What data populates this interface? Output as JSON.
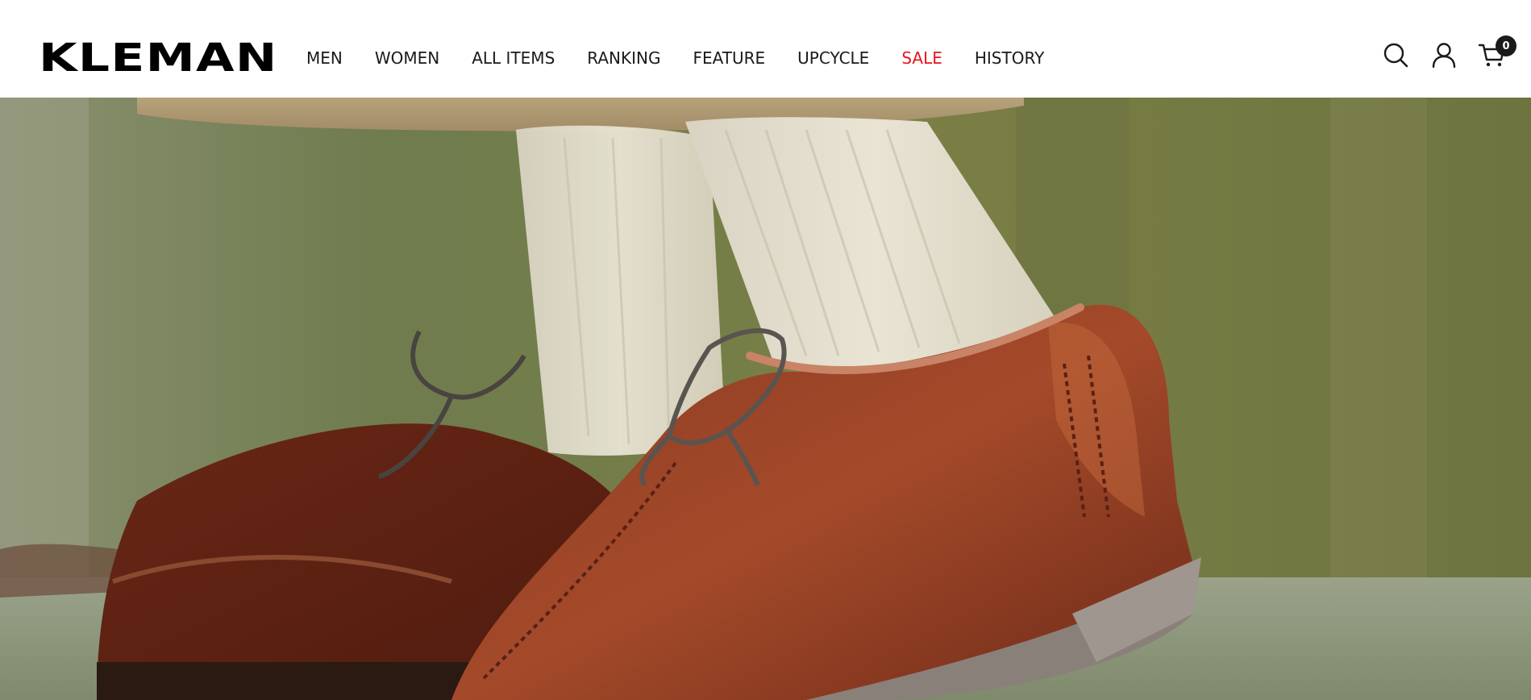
{
  "header": {
    "logo": "KLEMAN",
    "nav": [
      {
        "label": "MEN"
      },
      {
        "label": "WOMEN"
      },
      {
        "label": "ALL ITEMS"
      },
      {
        "label": "RANKING"
      },
      {
        "label": "FEATURE"
      },
      {
        "label": "UPCYCLE"
      },
      {
        "label": "SALE"
      },
      {
        "label": "HISTORY"
      }
    ],
    "icons": {
      "search": "search-icon",
      "account": "user-icon",
      "cart": "cart-icon"
    },
    "cart_count": "0"
  },
  "colors": {
    "sale": "#e8141d",
    "text": "#1a1a1a",
    "badge": "#1a1a1a"
  },
  "hero": {
    "image": "photo of brown leather lace-up shoes with cream ribbed socks and khaki trousers against a mossy green wall"
  }
}
